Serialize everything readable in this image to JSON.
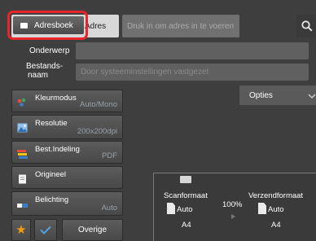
{
  "header": {
    "addressbook_label": "Adresboek",
    "address_label": "Adres",
    "address_placeholder": "Druk in om adres in te voeren",
    "search_icon": "search-icon"
  },
  "fields": {
    "subject_label": "Onderwerp",
    "subject_value": "",
    "filename_label_line1": "Bestands-",
    "filename_label_line2": "naam",
    "filename_placeholder": "Door systeeminstellingen vastgezet"
  },
  "options_label": "Opties",
  "settings": [
    {
      "label": "Kleurmodus",
      "value": "Auto/Mono",
      "icon": "color-mode-icon"
    },
    {
      "label": "Resolutie",
      "value": "200x200dpi",
      "icon": "resolution-icon"
    },
    {
      "label": "Best.Indeling",
      "value": "PDF",
      "icon": "file-format-icon"
    },
    {
      "label": "Origineel",
      "value": "",
      "icon": "original-icon"
    },
    {
      "label": "Belichting",
      "value": "Auto",
      "icon": "exposure-icon"
    }
  ],
  "bottom": {
    "favorite_icon": "star-icon",
    "check_icon": "checkmark-icon",
    "other_label": "Overige"
  },
  "preview": {
    "scan_size_label": "Scanformaat",
    "scan_size_value": "Auto",
    "scan_paper": "A4",
    "ratio": "100%",
    "send_size_label": "Verzendformaat",
    "send_size_value": "Auto",
    "send_paper": "A4"
  },
  "colors": {
    "highlight": "#e8252b",
    "accent": "#3d7fc4"
  }
}
